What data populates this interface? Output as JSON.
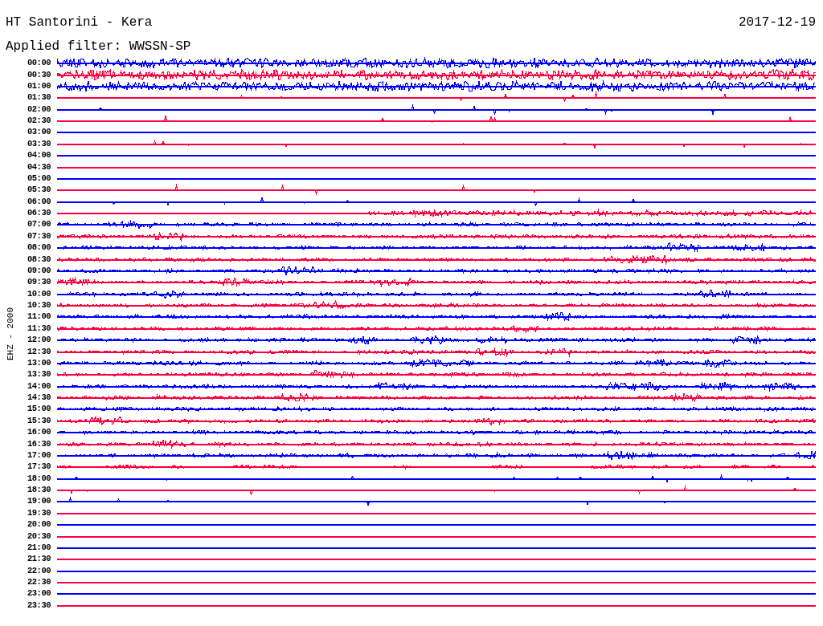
{
  "title": "HT Santorini - Kera",
  "date": "2017-12-19",
  "filter": "Applied filter: WWSSN-SP",
  "axis_label": "EHZ - 2000",
  "traces": [
    {
      "time": "00:00",
      "color": "#0000ff",
      "kind": "strong"
    },
    {
      "time": "00:30",
      "color": "#ff0040",
      "kind": "strong"
    },
    {
      "time": "01:00",
      "color": "#0000ff",
      "kind": "strong"
    },
    {
      "time": "01:30",
      "color": "#ff0040",
      "kind": "spiky"
    },
    {
      "time": "02:00",
      "color": "#0000ff",
      "kind": "spiky"
    },
    {
      "time": "02:30",
      "color": "#ff0040",
      "kind": "spiky"
    },
    {
      "time": "03:00",
      "color": "#0000ff",
      "kind": "flat"
    },
    {
      "time": "03:30",
      "color": "#ff0040",
      "kind": "spiky"
    },
    {
      "time": "04:00",
      "color": "#0000ff",
      "kind": "flat"
    },
    {
      "time": "04:30",
      "color": "#ff0040",
      "kind": "flat"
    },
    {
      "time": "05:00",
      "color": "#0000ff",
      "kind": "flat"
    },
    {
      "time": "05:30",
      "color": "#ff0040",
      "kind": "spiky"
    },
    {
      "time": "06:00",
      "color": "#0000ff",
      "kind": "spiky"
    },
    {
      "time": "06:30",
      "color": "#ff0040",
      "kind": "onset"
    },
    {
      "time": "07:00",
      "color": "#0000ff",
      "kind": "moderate"
    },
    {
      "time": "07:30",
      "color": "#ff0040",
      "kind": "moderate"
    },
    {
      "time": "08:00",
      "color": "#0000ff",
      "kind": "moderate"
    },
    {
      "time": "08:30",
      "color": "#ff0040",
      "kind": "moderate"
    },
    {
      "time": "09:00",
      "color": "#0000ff",
      "kind": "moderate"
    },
    {
      "time": "09:30",
      "color": "#ff0040",
      "kind": "moderate"
    },
    {
      "time": "10:00",
      "color": "#0000ff",
      "kind": "moderate"
    },
    {
      "time": "10:30",
      "color": "#ff0040",
      "kind": "moderate"
    },
    {
      "time": "11:00",
      "color": "#0000ff",
      "kind": "moderate"
    },
    {
      "time": "11:30",
      "color": "#ff0040",
      "kind": "moderate"
    },
    {
      "time": "12:00",
      "color": "#0000ff",
      "kind": "moderate"
    },
    {
      "time": "12:30",
      "color": "#ff0040",
      "kind": "moderate"
    },
    {
      "time": "13:00",
      "color": "#0000ff",
      "kind": "moderate"
    },
    {
      "time": "13:30",
      "color": "#ff0040",
      "kind": "moderate"
    },
    {
      "time": "14:00",
      "color": "#0000ff",
      "kind": "moderate"
    },
    {
      "time": "14:30",
      "color": "#ff0040",
      "kind": "moderate"
    },
    {
      "time": "15:00",
      "color": "#0000ff",
      "kind": "moderate"
    },
    {
      "time": "15:30",
      "color": "#ff0040",
      "kind": "moderate"
    },
    {
      "time": "16:00",
      "color": "#0000ff",
      "kind": "moderate"
    },
    {
      "time": "16:30",
      "color": "#ff0040",
      "kind": "moderate"
    },
    {
      "time": "17:00",
      "color": "#0000ff",
      "kind": "moderate"
    },
    {
      "time": "17:30",
      "color": "#ff0040",
      "kind": "patchy"
    },
    {
      "time": "18:00",
      "color": "#0000ff",
      "kind": "spiky"
    },
    {
      "time": "18:30",
      "color": "#ff0040",
      "kind": "spiky"
    },
    {
      "time": "19:00",
      "color": "#0000ff",
      "kind": "spiky"
    },
    {
      "time": "19:30",
      "color": "#ff0040",
      "kind": "flat"
    },
    {
      "time": "20:00",
      "color": "#0000ff",
      "kind": "flat"
    },
    {
      "time": "20:30",
      "color": "#ff0040",
      "kind": "flat"
    },
    {
      "time": "21:00",
      "color": "#0000ff",
      "kind": "flat"
    },
    {
      "time": "21:30",
      "color": "#ff0040",
      "kind": "flat"
    },
    {
      "time": "22:00",
      "color": "#0000ff",
      "kind": "flat"
    },
    {
      "time": "22:30",
      "color": "#ff0040",
      "kind": "flat"
    },
    {
      "time": "23:00",
      "color": "#0000ff",
      "kind": "flat"
    },
    {
      "time": "23:30",
      "color": "#ff0040",
      "kind": "flat"
    }
  ]
}
